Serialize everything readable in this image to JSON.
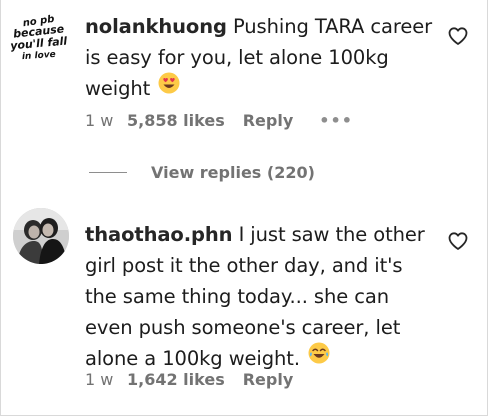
{
  "comments": [
    {
      "username": "nolankhuong",
      "text": "Pushing TARA career is easy for you, let alone 100kg weight",
      "emoji": "heart-eyes-emoji",
      "time": "1 w",
      "likes": "5,858 likes",
      "reply_label": "Reply",
      "more_label": "•••",
      "avatar_text": [
        "no pb",
        "because",
        "you'll fall",
        "in love"
      ]
    },
    {
      "username": "thaothao.phn",
      "text": "I just saw the other girl post it the other day, and it's the same thing today... she can even push someone's career, let alone a 100kg weight.",
      "emoji": "tears-of-joy-emoji",
      "time": "1 w",
      "likes": "1,642 likes",
      "reply_label": "Reply"
    }
  ],
  "view_replies": "View replies (220)",
  "colors": {
    "text": "#262626",
    "secondary": "#737373",
    "emoji": "#fdca47",
    "heart": "#e4354c"
  }
}
